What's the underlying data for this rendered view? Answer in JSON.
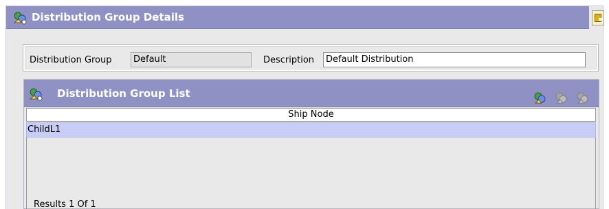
{
  "header": {
    "title": "Distribution Group Details",
    "title_icon": "distribution-group-icon",
    "save_icon": "save-icon"
  },
  "details": {
    "distribution_group_label": "Distribution Group",
    "distribution_group_value": "Default",
    "description_label": "Description",
    "description_value": "Default Distribution"
  },
  "list": {
    "title": "Distribution Group List",
    "title_icon": "distribution-group-icon",
    "actions": [
      "add-icon",
      "edit-icon-disabled",
      "delete-icon-disabled"
    ],
    "columns": [
      "Ship Node"
    ],
    "rows": [
      {
        "ship_node": "ChildL1"
      }
    ],
    "results_text": "Results  1   Of  1"
  }
}
